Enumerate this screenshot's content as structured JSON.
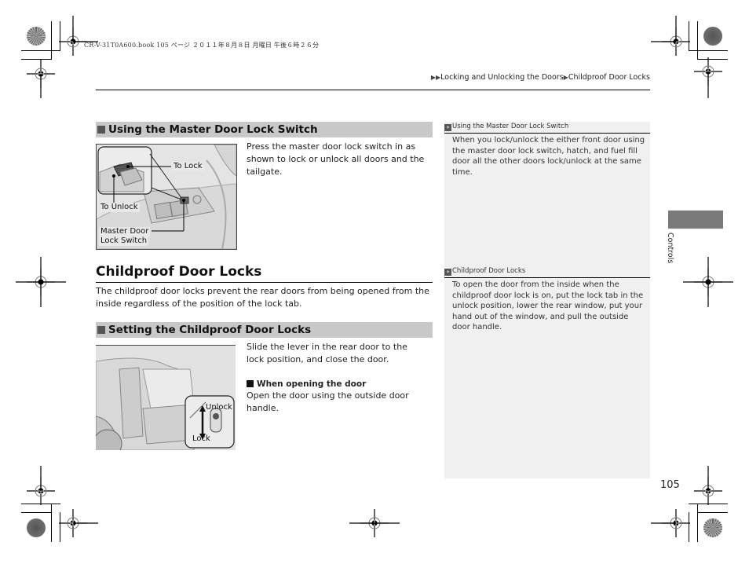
{
  "file_header": "CR-V-31T0A600.book  105 ページ  ２０１１年８月８日  月曜日  午後６時２６分",
  "breadcrumb": {
    "prefix_icon": "double-triangle-right",
    "items": [
      "Locking and Unlocking the Doors",
      "Childproof Door Locks"
    ],
    "separator_icon": "triangle-right"
  },
  "section_master": {
    "heading": "Using the Master Door Lock Switch",
    "text": "Press the master door lock switch in as shown to lock or unlock all doors and the tailgate.",
    "figure_callouts": {
      "to_lock": "To Lock",
      "to_unlock": "To Unlock",
      "master_switch_line1": "Master Door",
      "master_switch_line2": "Lock Switch"
    }
  },
  "chapter": {
    "title": "Childproof Door Locks",
    "intro": "The childproof door locks prevent the rear doors from being opened from the inside regardless of the position of the lock tab."
  },
  "section_setting": {
    "heading": "Setting the Childproof Door Locks",
    "text": "Slide the lever in the rear door to the lock position, and close the door.",
    "subheading": "When opening the door",
    "subtext": "Open the door using the outside door handle.",
    "figure_callouts": {
      "unlock": "Unlock",
      "lock": "Lock"
    }
  },
  "sidebar": {
    "notes": [
      {
        "title": "Using the Master Door Lock Switch",
        "text": "When you lock/unlock the either front door using the master door lock switch, hatch, and fuel fill door all the other doors lock/unlock at the same time."
      },
      {
        "title": "Childproof Door Locks",
        "text": "To open the door from the inside when the childproof door lock is on, put the lock tab in the unlock position, lower the rear window, put your hand out of the window, and pull the outside door handle."
      }
    ]
  },
  "side_tab": {
    "label": "Controls"
  },
  "page_number": "105",
  "colors": {
    "section_header_bg": "#c8c8c8",
    "sidebar_bg": "#f0f0f0",
    "tab_bg": "#7a7a7a"
  }
}
